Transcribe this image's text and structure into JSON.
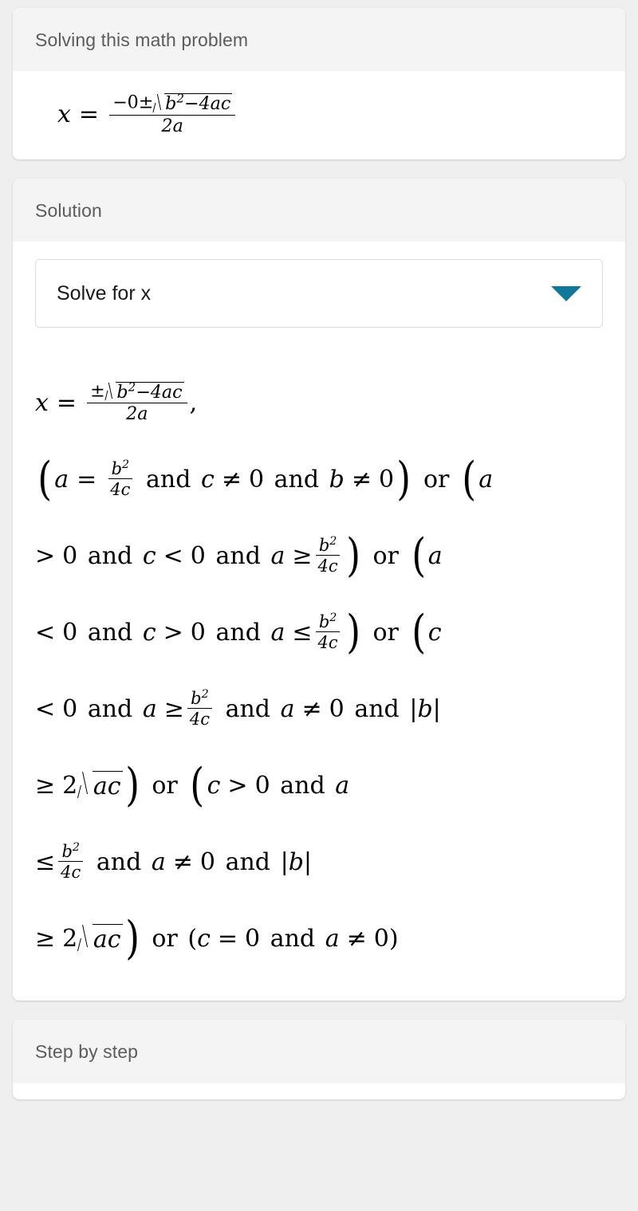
{
  "page": {
    "background_color": "#efefef",
    "accent_color": "#10799a"
  },
  "problem_card": {
    "title": "Solving this math problem",
    "formula_plain": "x = (-0 ± sqrt(b^2 - 4ac)) / (2a)",
    "formula_parts": {
      "lhs_var": "x",
      "equals": "=",
      "numerator_prefix": "−0±",
      "radicand_base": "b",
      "radicand_exp": "2",
      "radicand_rest": "−4ac",
      "denominator": "2a"
    }
  },
  "solution_card": {
    "title": "Solution",
    "dropdown": {
      "name": "solve-for-selector",
      "selected": "Solve for x",
      "icon": "chevron-down-icon"
    },
    "result_plain": "x = ±sqrt(b^2-4ac)/(2a), (a = b^2/(4c) and c ≠ 0 and b ≠ 0) or (a > 0 and c < 0 and a ≥ b^2/(4c)) or (a < 0 and c > 0 and a ≤ b^2/(4c)) or (c < 0 and a ≥ b^2/(4c) and a ≠ 0 and |b| ≥ 2 sqrt(ac)) or (c > 0 and a ≤ b^2/(4c) and a ≠ 0 and |b| ≥ 2 sqrt(ac)) or (c = 0 and a ≠ 0)",
    "lines": {
      "l1": {
        "lhs_var": "x",
        "equals": "=",
        "numerator_prefix": "±",
        "radicand_base": "b",
        "radicand_exp": "2",
        "radicand_rest": "−4ac",
        "denominator": "2a",
        "trailing": ","
      },
      "l2": {
        "open_paren": "(",
        "var_a": "a",
        "equals": "=",
        "frac_num_base": "b",
        "frac_num_exp": "2",
        "frac_den": "4c",
        "and1": "and",
        "var_c": "c",
        "neq1": "≠",
        "zero1": "0",
        "and2": "and",
        "var_b": "b",
        "neq2": "≠",
        "zero2": "0",
        "close_paren": ")",
        "or": "or",
        "open_paren2": "(",
        "tail_var": "a"
      },
      "l3": {
        "gt": ">",
        "zero1": "0",
        "and1": "and",
        "var_c": "c",
        "lt": "<",
        "zero2": "0",
        "and2": "and",
        "var_a": "a",
        "ge": "≥",
        "frac_num_base": "b",
        "frac_num_exp": "2",
        "frac_den": "4c",
        "close_paren": ")",
        "or": "or",
        "open_paren": "(",
        "tail_var": "a"
      },
      "l4": {
        "lt": "<",
        "zero1": "0",
        "and1": "and",
        "var_c": "c",
        "gt": ">",
        "zero2": "0",
        "and2": "and",
        "var_a": "a",
        "le": "≤",
        "frac_num_base": "b",
        "frac_num_exp": "2",
        "frac_den": "4c",
        "close_paren": ")",
        "or": "or",
        "open_paren": "(",
        "tail_var": "c"
      },
      "l5": {
        "lt": "<",
        "zero1": "0",
        "and1": "and",
        "var_a": "a",
        "ge": "≥",
        "frac_num_base": "b",
        "frac_num_exp": "2",
        "frac_den": "4c",
        "and2": "and",
        "var_a2": "a",
        "neq": "≠",
        "zero2": "0",
        "and3": "and",
        "abs_b": "|b|"
      },
      "l6": {
        "ge": "≥",
        "two": "2",
        "radicand": "ac",
        "close_paren": ")",
        "or": "or",
        "open_paren": "(",
        "var_c": "c",
        "gt": ">",
        "zero": "0",
        "and": "and",
        "tail_var": "a"
      },
      "l7": {
        "le": "≤",
        "frac_num_base": "b",
        "frac_num_exp": "2",
        "frac_den": "4c",
        "and1": "and",
        "var_a": "a",
        "neq": "≠",
        "zero": "0",
        "and2": "and",
        "abs_b": "|b|"
      },
      "l8": {
        "ge": "≥",
        "two": "2",
        "radicand": "ac",
        "close_paren": ")",
        "or": "or",
        "open_paren": "(",
        "var_c": "c",
        "equals": "=",
        "zero1": "0",
        "and": "and",
        "var_a": "a",
        "neq": "≠",
        "zero2": "0",
        "close_paren2": ")"
      }
    }
  },
  "step_card": {
    "title": "Step by step"
  }
}
